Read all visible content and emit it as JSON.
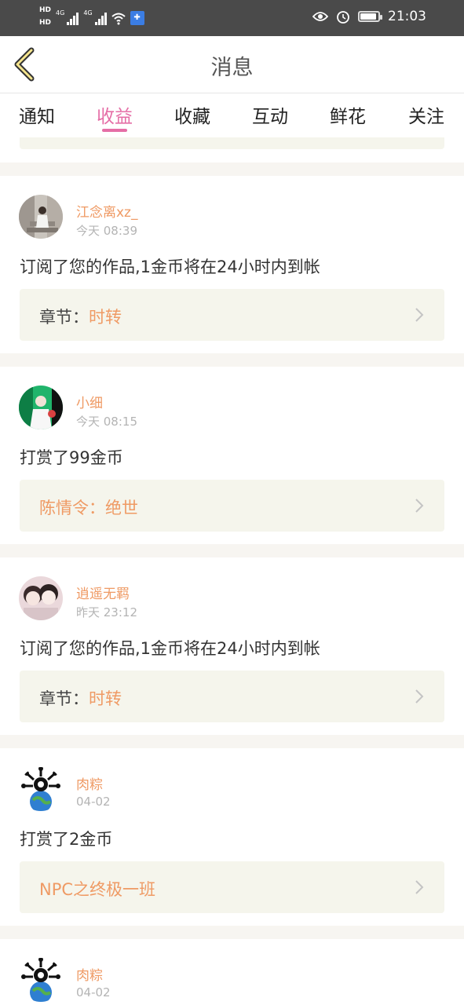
{
  "status_bar": {
    "hd1": "HD",
    "hd2": "HD",
    "net1": "4G",
    "net2": "4G",
    "time": "21:03"
  },
  "header": {
    "title": "消息"
  },
  "tabs": [
    {
      "label": "通知",
      "active": false
    },
    {
      "label": "收益",
      "active": true
    },
    {
      "label": "收藏",
      "active": false
    },
    {
      "label": "互动",
      "active": false
    },
    {
      "label": "鲜花",
      "active": false
    },
    {
      "label": "关注",
      "active": false
    }
  ],
  "messages": [
    {
      "user": "江念离xz_",
      "time": "今天 08:39",
      "text": "订阅了您的作品,1金币将在24小时内到帐",
      "ref_prefix": "章节：",
      "ref_title": "时转"
    },
    {
      "user": "小细",
      "time": "今天 08:15",
      "text": "打赏了99金币",
      "ref_prefix": "",
      "ref_title": "陈情令：绝世"
    },
    {
      "user": "逍遥无羁",
      "time": "昨天 23:12",
      "text": "订阅了您的作品,1金币将在24小时内到帐",
      "ref_prefix": "章节：",
      "ref_title": "时转"
    },
    {
      "user": "肉粽",
      "time": "04-02",
      "text": "打赏了2金币",
      "ref_prefix": "",
      "ref_title": "NPC之终极一班"
    },
    {
      "user": "肉粽",
      "time": "04-02"
    }
  ],
  "colors": {
    "accent": "#e56ea6",
    "name": "#ef9a64",
    "ref_bg": "#f5f5ec",
    "statusbar": "#4a4a4a"
  }
}
